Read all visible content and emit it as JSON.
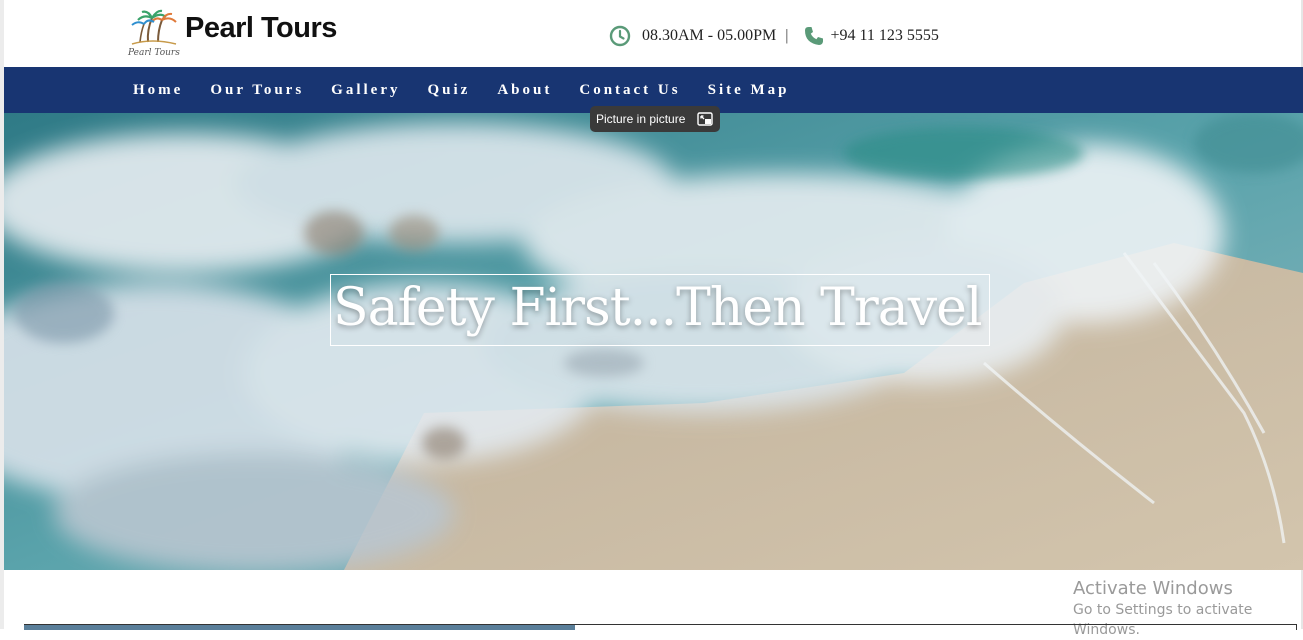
{
  "header": {
    "brand": "Pearl Tours",
    "logo_icon": "palm-tree-logo-icon",
    "hours": "08.30AM -  05.00PM",
    "separator": "|",
    "phone": "+94 11 123 5555",
    "clock_icon": "clock-icon",
    "phone_icon": "phone-icon"
  },
  "nav": {
    "items": [
      "Home",
      "Our Tours",
      "Gallery",
      "Quiz",
      "About",
      "Contact Us",
      "Site Map"
    ]
  },
  "tooltip": {
    "label": "Picture in picture"
  },
  "hero": {
    "title": "Safety First...Then Travel"
  },
  "watermark": {
    "line1": "Activate Windows",
    "line2": "Go to Settings to activate Windows."
  },
  "colors": {
    "nav_bg": "#183572",
    "icon_green": "#5a9a78",
    "ocean": "#3e8f99",
    "sand": "#c9b9a1"
  }
}
